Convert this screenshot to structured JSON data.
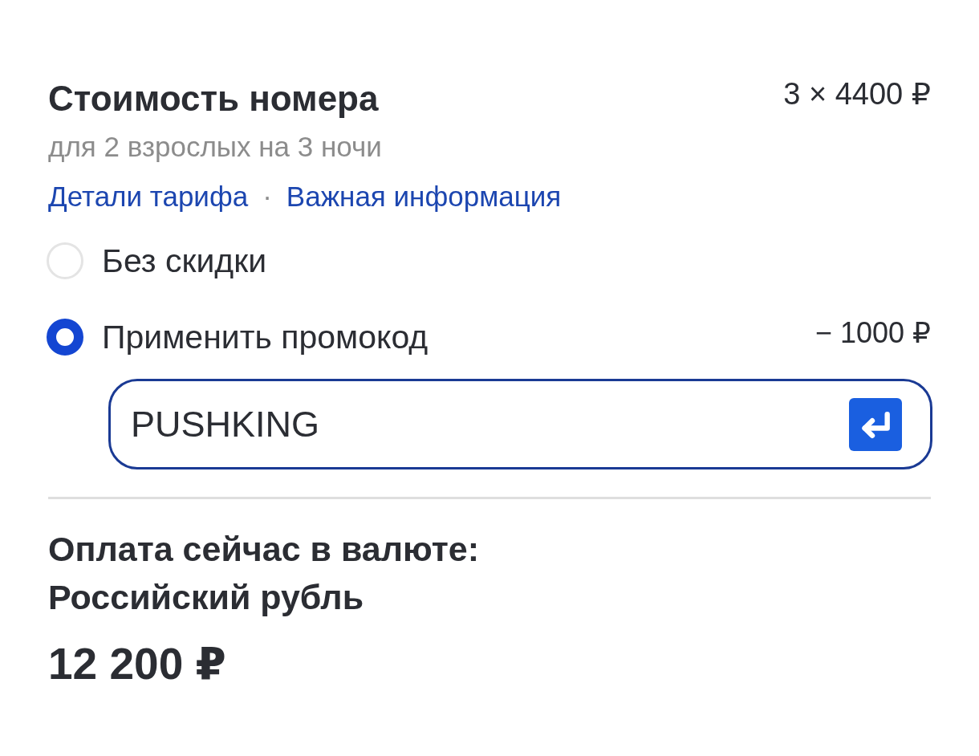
{
  "room_price": {
    "title": "Стоимость номера",
    "price": "3 × 4400 ₽",
    "subtitle": "для 2 взрослых на 3 ночи",
    "links": [
      {
        "label": "Детали тарифа"
      },
      {
        "label": "Важная информация"
      }
    ],
    "link_separator": "·"
  },
  "discount_options": [
    {
      "label": "Без скидки",
      "selected": false
    },
    {
      "label": "Применить промокод",
      "selected": true,
      "amount": "− 1000 ₽"
    }
  ],
  "promo_field": {
    "value": "PUSHKING"
  },
  "payment": {
    "label": "Оплата сейчас в валюте:",
    "currency": "Российский рубль",
    "total": "12 200 ₽"
  }
}
